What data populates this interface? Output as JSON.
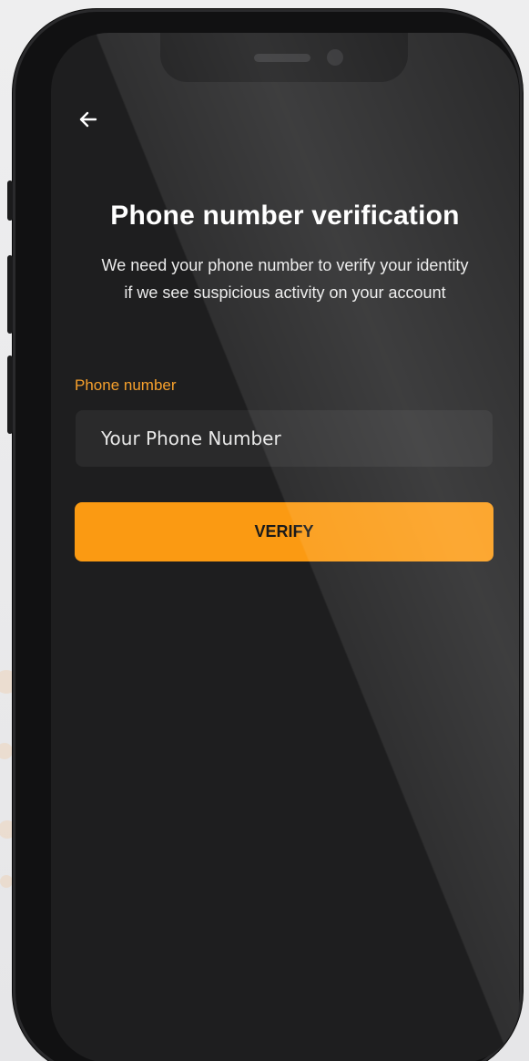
{
  "screen": {
    "title": "Phone number verification",
    "subtitle": "We need your phone number to verify your identity if we see suspicious activity on your account"
  },
  "icons": {
    "back": "arrow-left-icon"
  },
  "form": {
    "phone_label": "Phone number",
    "phone_placeholder": "Your Phone Number",
    "phone_value": ""
  },
  "actions": {
    "verify_label": "VERIFY"
  },
  "colors": {
    "accent": "#fb9a12",
    "label": "#f6a02c",
    "screen_bg": "#1e1e1f",
    "input_bg": "#2a2a2b"
  }
}
